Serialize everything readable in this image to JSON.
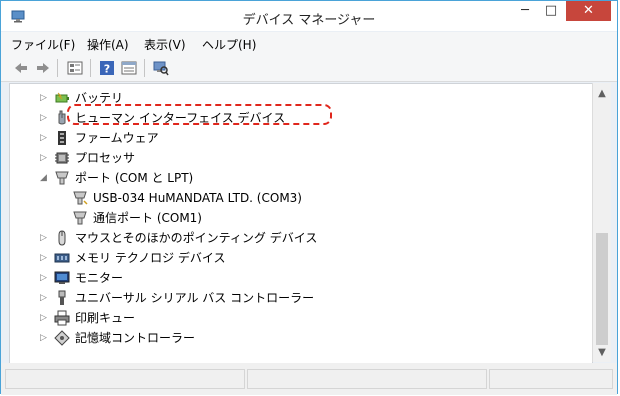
{
  "window": {
    "title": "デバイス マネージャー",
    "controls": {
      "minimize": "─",
      "maximize": "□",
      "close": "✕"
    }
  },
  "menu": [
    "ファイル(F)",
    "操作(A)",
    "表示(V)",
    "ヘルプ(H)"
  ],
  "toolbar": [
    "back-icon",
    "forward-icon",
    "device-view-icon",
    "help-icon",
    "properties-icon",
    "scan-hardware-icon"
  ],
  "tree": [
    {
      "label": "バッテリ",
      "icon": "battery-icon",
      "expander": "▷"
    },
    {
      "label": "ヒューマン インターフェイス デバイス",
      "icon": "hid-icon",
      "expander": "▷"
    },
    {
      "label": "ファームウェア",
      "icon": "firmware-icon",
      "expander": "▷"
    },
    {
      "label": "プロセッサ",
      "icon": "processor-icon",
      "expander": "▷"
    },
    {
      "label": "ポート (COM と LPT)",
      "icon": "port-icon",
      "expander": "◢"
    },
    {
      "label": "USB-034 HuMANDATA LTD. (COM3)",
      "icon": "port-icon",
      "expander": ""
    },
    {
      "label": "通信ポート (COM1)",
      "icon": "port-icon",
      "expander": ""
    },
    {
      "label": "マウスとそのほかのポインティング デバイス",
      "icon": "mouse-icon",
      "expander": "▷"
    },
    {
      "label": "メモリ テクノロジ デバイス",
      "icon": "memory-icon",
      "expander": "▷"
    },
    {
      "label": "モニター",
      "icon": "monitor-icon",
      "expander": "▷"
    },
    {
      "label": "ユニバーサル シリアル バス コントローラー",
      "icon": "usb-icon",
      "expander": "▷"
    },
    {
      "label": "印刷キュー",
      "icon": "printer-icon",
      "expander": "▷"
    },
    {
      "label": "記憶域コントローラー",
      "icon": "storage-icon",
      "expander": "▷"
    }
  ],
  "scrollbar": {
    "up": "▲",
    "down": "▼",
    "position": 0.85
  },
  "colors": {
    "highlight_border": "#e0261c",
    "close_button": "#c7463c",
    "window_border": "#4aa3d8"
  }
}
